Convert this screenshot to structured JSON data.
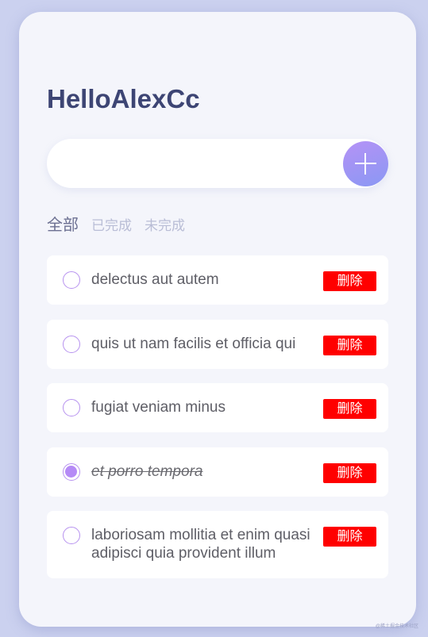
{
  "app": {
    "title": "HelloAlexCc"
  },
  "input": {
    "value": "",
    "placeholder": ""
  },
  "icons": {
    "add": "plus-icon",
    "unchecked": "circle-icon",
    "checked": "filled-circle-icon"
  },
  "colors": {
    "accent_gradient_start": "#b592f6",
    "accent_gradient_end": "#8a98f3",
    "delete": "#ff0000",
    "title": "#3d4574",
    "background": "#cbd1ef",
    "card": "#f4f5fb"
  },
  "filters": [
    {
      "label": "全部",
      "active": true
    },
    {
      "label": "已完成",
      "active": false
    },
    {
      "label": "未完成",
      "active": false
    }
  ],
  "todos": [
    {
      "text": "delectus aut autem",
      "completed": false,
      "delete_label": "删除"
    },
    {
      "text": "quis ut nam facilis et officia qui",
      "completed": false,
      "delete_label": "删除"
    },
    {
      "text": "fugiat veniam minus",
      "completed": false,
      "delete_label": "删除"
    },
    {
      "text": "et porro tempora",
      "completed": true,
      "delete_label": "删除"
    },
    {
      "text": "laboriosam mollitia et enim quasi adipisci quia provident illum",
      "completed": false,
      "delete_label": "删除"
    }
  ],
  "watermark": "@稀土掘金技术社区"
}
